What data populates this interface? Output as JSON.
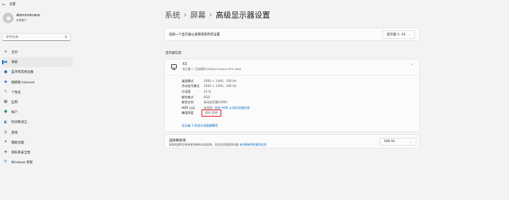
{
  "window": {
    "title": "设置",
    "back_glyph": "←"
  },
  "profile": {
    "name": "Administrator",
    "subtitle": "本地帐户"
  },
  "search": {
    "placeholder": "查找设置",
    "icon": "search-icon"
  },
  "nav": [
    {
      "label": "主页",
      "icon": "⌂",
      "icon_name": "home-icon",
      "color": "#444444",
      "active": false
    },
    {
      "label": "系统",
      "icon": "▬",
      "icon_name": "system-icon",
      "color": "#0078d4",
      "active": true
    },
    {
      "label": "蓝牙和其他设备",
      "icon": "●",
      "icon_name": "bluetooth-icon",
      "color": "#1a73c8",
      "active": false
    },
    {
      "label": "网络和 Internet",
      "icon": "◆",
      "icon_name": "network-icon",
      "color": "#3a7bd5",
      "active": false
    },
    {
      "label": "个性化",
      "icon": "✎",
      "icon_name": "personalization-icon",
      "color": "#c07020",
      "active": false
    },
    {
      "label": "应用",
      "icon": "▦",
      "icon_name": "apps-icon",
      "color": "#506070",
      "active": false
    },
    {
      "label": "帐户",
      "icon": "●",
      "icon_name": "accounts-icon",
      "color": "#2e9e5a",
      "active": false
    },
    {
      "label": "时间和语言",
      "icon": "◐",
      "icon_name": "time-language-icon",
      "color": "#1d6fb8",
      "active": false
    },
    {
      "label": "游戏",
      "icon": "◎",
      "icon_name": "gaming-icon",
      "color": "#555555",
      "active": false
    },
    {
      "label": "辅助功能",
      "icon": "✦",
      "icon_name": "accessibility-icon",
      "color": "#1f5ea8",
      "active": false
    },
    {
      "label": "隐私和安全性",
      "icon": "◈",
      "icon_name": "privacy-icon",
      "color": "#666666",
      "active": false
    },
    {
      "label": "Windows 更新",
      "icon": "↻",
      "icon_name": "windows-update-icon",
      "color": "#0078d4",
      "active": false
    }
  ],
  "breadcrumb": {
    "items": [
      "系统",
      "屏幕",
      "高级显示器设置"
    ],
    "separator": "›"
  },
  "select_display": {
    "label": "选择一个显示器以查看或更改其设置",
    "value": "显示器 1: X3"
  },
  "display_info": {
    "section_title": "显示器信息",
    "name": "X3",
    "subtitle": "显示器 1: 已连接到 NVIDIA GeForce RTX 4060",
    "props": [
      {
        "key": "桌面模式",
        "value": "2560 × 1440，160 Hz"
      },
      {
        "key": "活动信号模式",
        "value": "2560 × 1440，160 Hz"
      },
      {
        "key": "位深度",
        "value": "10 位"
      },
      {
        "key": "颜色格式",
        "value": "RGB"
      },
      {
        "key": "颜色空间",
        "value": "高动态范围(HDR)"
      },
      {
        "key": "HDR 认证",
        "value": "未找到",
        "link": "有关 HDR 认证的详细信息"
      },
      {
        "key": "峰值亮度",
        "value": "400 尼特",
        "highlight": true
      }
    ],
    "adapter_link": "显示器 1 的显示适配器属性"
  },
  "refresh": {
    "title": "选择刷新率",
    "desc": "较高的速率会带来更流畅的动态效果，但也会消耗更多电量",
    "desc_link": "有关刷新率的更多信息",
    "value": "160 Hz"
  }
}
